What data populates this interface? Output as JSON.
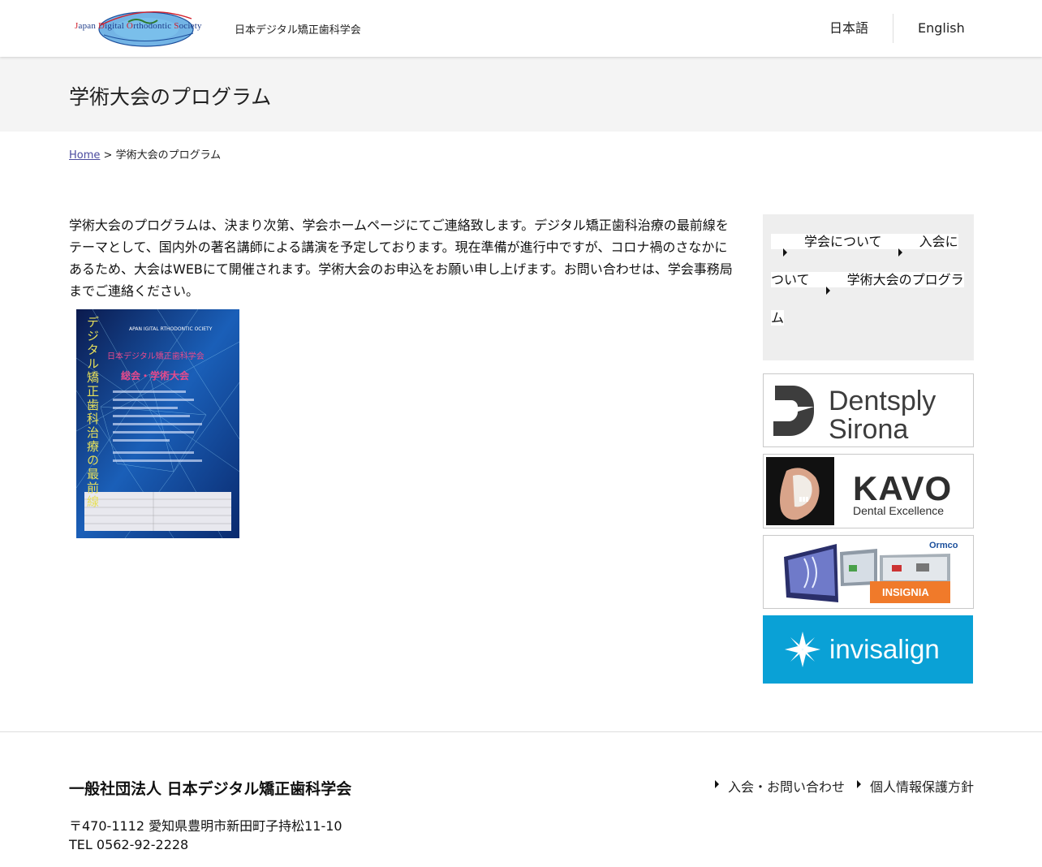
{
  "header": {
    "logo_text_parts": [
      "J",
      "apan ",
      "D",
      "igital ",
      "O",
      "rthodontic ",
      "S",
      "ociety"
    ],
    "site_name": "日本デジタル矯正歯科学会",
    "lang_ja": "日本語",
    "lang_en": "English"
  },
  "page": {
    "title": "学術大会のプログラム"
  },
  "breadcrumb": {
    "home": "Home",
    "separator": " > ",
    "current": "学術大会のプログラム"
  },
  "main": {
    "intro": "学術大会のプログラムは、決まり次第、学会ホームページにてご連絡致します。デジタル矯正歯科治療の最前線をテーマとして、国内外の著名講師による講演を予定しております。現在準備が進行中ですが、コロナ禍のさなかにあるため、大会はWEBにて開催されます。学術大会のお申込をお願い申し上げます。お問い合わせは、学会事務局までご連絡ください。",
    "poster": {
      "society_line": "APAN IGITAL RTHODONTIC OCIETY",
      "vertical_title": "デジタル矯正歯科治療の最前線",
      "heading": "日本デジタル矯正歯科学会",
      "subheading": "総会・学術大会"
    }
  },
  "sidebar": {
    "nav": [
      {
        "label": "学会について"
      },
      {
        "label": "入会について"
      },
      {
        "label": "学術大会のプログラム"
      }
    ],
    "banners": {
      "dentsply_line1": "Dentsply",
      "dentsply_line2": "Sirona",
      "kavo_name": "KAVO",
      "kavo_tagline": "Dental Excellence",
      "ormco_brand": "Ormco",
      "insignia": "INSIGNIA",
      "invisalign": "invisalign"
    }
  },
  "footer": {
    "org": "一般社団法人 日本デジタル矯正歯科学会",
    "address": "〒470-1112 愛知県豊明市新田町子持松11-10",
    "tel": "TEL 0562-92-2228",
    "links": [
      {
        "label": "入会・お問い合わせ"
      },
      {
        "label": "個人情報保護方針"
      }
    ]
  },
  "colors": {
    "band_bg": "#f4f4f4",
    "invisalign_bg": "#0aa1d6",
    "link_blue": "#4a4a9e"
  }
}
